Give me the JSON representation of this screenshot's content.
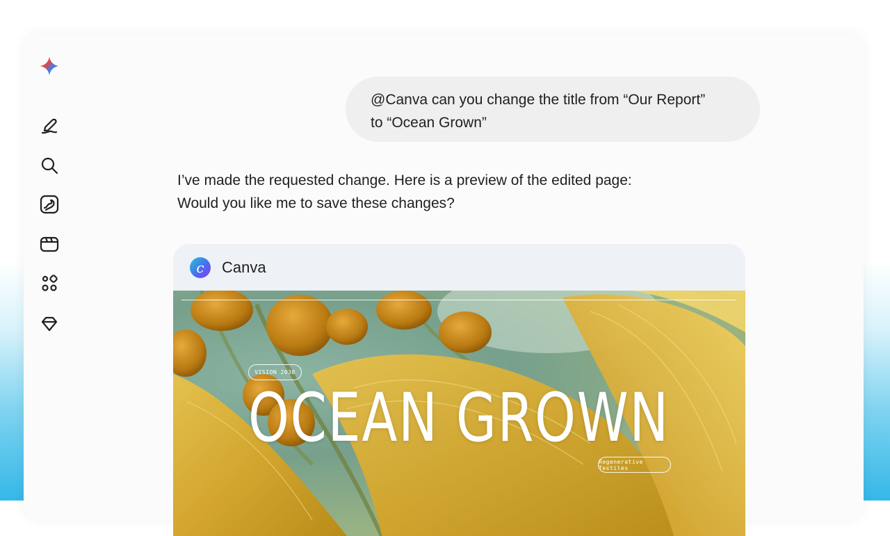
{
  "rail": {
    "icons": [
      "gemini-logo-icon",
      "edit-icon",
      "search-icon",
      "image-gen-icon",
      "video-icon",
      "apps-icon",
      "gem-icon"
    ]
  },
  "chat": {
    "user_line1": "@Canva can you change the title from “Our Report”",
    "user_line2": "to “Ocean Grown”",
    "reply_line1": "I’ve made the requested change. Here is a preview of the edited page:",
    "reply_line2": "Would you like me to save these changes?"
  },
  "card": {
    "app_name": "Canva",
    "logo_letter": "c"
  },
  "preview": {
    "tag_top": "VISION 2030",
    "title": "OCEAN GROWN",
    "tag_bottom": "Regenerative Textiles"
  }
}
